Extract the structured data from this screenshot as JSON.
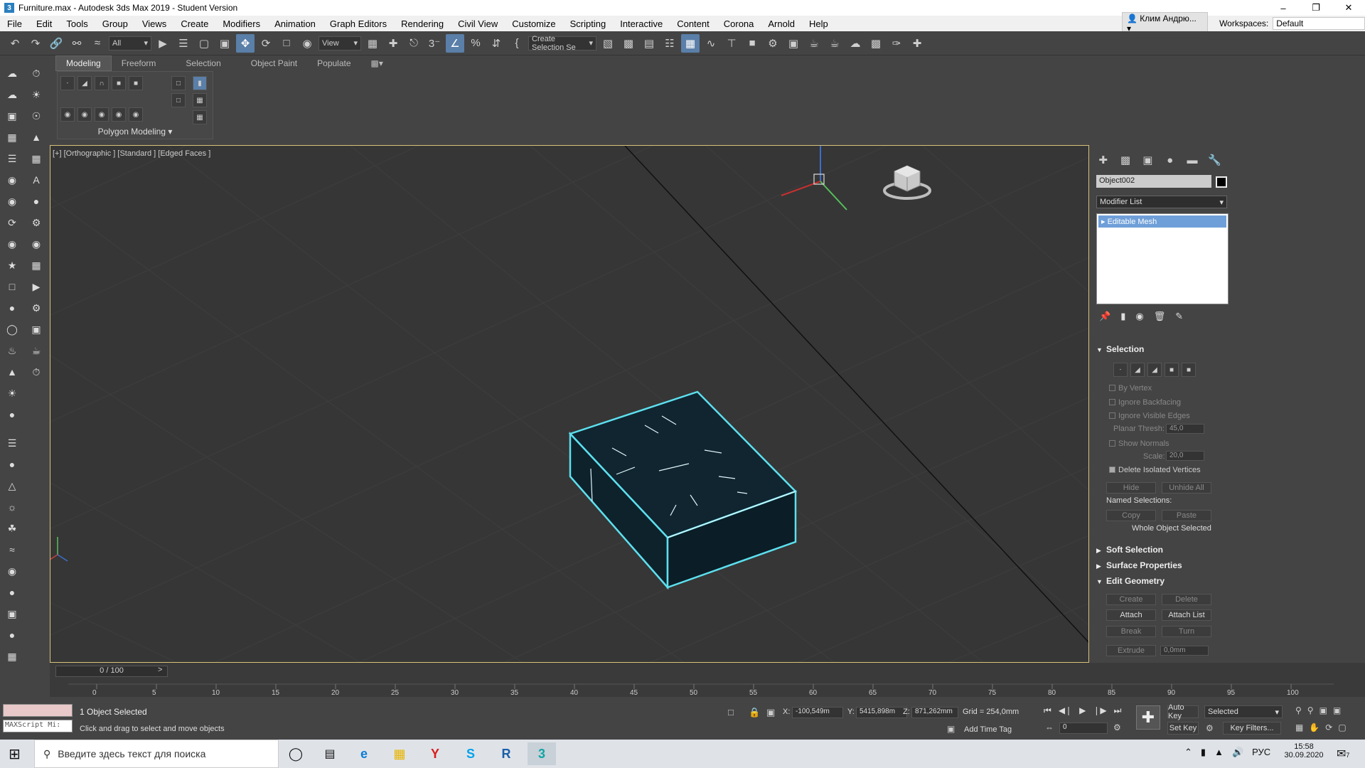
{
  "window": {
    "title": "Furniture.max - Autodesk 3ds Max 2019 - Student Version"
  },
  "menu": {
    "items": [
      "File",
      "Edit",
      "Tools",
      "Group",
      "Views",
      "Create",
      "Modifiers",
      "Animation",
      "Graph Editors",
      "Rendering",
      "Civil View",
      "Customize",
      "Scripting",
      "Interactive",
      "Content",
      "Corona",
      "Arnold",
      "Help"
    ],
    "user": "Клим Андрю...",
    "workspaces_label": "Workspaces:",
    "workspace": "Default"
  },
  "toolbar": {
    "filter": "All",
    "refcoord": "View",
    "selection_set": "Create Selection Se"
  },
  "ribbon": {
    "tabs": [
      "Modeling",
      "Freeform",
      "Selection",
      "Object Paint",
      "Populate"
    ],
    "panel_label": "Polygon Modeling"
  },
  "viewport": {
    "label": "[+] [Orthographic ] [Standard ] [Edged Faces ]"
  },
  "command_panel": {
    "object_name": "Object002",
    "modifier_list": "Modifier List",
    "stack_item": "Editable Mesh",
    "rollouts": {
      "selection": "Selection",
      "by_vertex": "By Vertex",
      "ignore_backfacing": "Ignore Backfacing",
      "ignore_visible_edges": "Ignore Visible Edges",
      "planar_thresh_label": "Planar Thresh:",
      "planar_thresh": "45,0",
      "show_normals": "Show Normals",
      "scale_label": "Scale:",
      "scale": "20,0",
      "delete_isolated": "Delete Isolated Vertices",
      "hide": "Hide",
      "unhide_all": "Unhide All",
      "named_selections": "Named Selections:",
      "copy": "Copy",
      "paste": "Paste",
      "whole_object": "Whole Object Selected",
      "soft_selection": "Soft Selection",
      "surface_properties": "Surface Properties",
      "edit_geometry": "Edit Geometry",
      "create": "Create",
      "delete": "Delete",
      "attach": "Attach",
      "attach_list": "Attach List",
      "break": "Break",
      "turn": "Turn",
      "extrude": "Extrude",
      "extrude_val": "0,0mm"
    }
  },
  "timeline": {
    "slider": "0 / 100",
    "ticks": [
      "0",
      "5",
      "10",
      "15",
      "20",
      "25",
      "30",
      "35",
      "40",
      "45",
      "50",
      "55",
      "60",
      "65",
      "70",
      "75",
      "80",
      "85",
      "90",
      "95",
      "100"
    ]
  },
  "status": {
    "maxscript": "MAXScript Mi:",
    "selected": "1 Object Selected",
    "prompt": "Click and drag to select and move objects",
    "x_label": "X:",
    "x": "-100,549m",
    "y_label": "Y:",
    "y": "5415,898m",
    "z_label": "Z:",
    "z": "871,262mm",
    "grid": "Grid = 254,0mm",
    "add_time_tag": "Add Time Tag",
    "auto_key": "Auto Key",
    "set_key": "Set Key",
    "key_selected": "Selected",
    "key_filters": "Key Filters...",
    "frame": "0"
  },
  "taskbar": {
    "search_placeholder": "Введите здесь текст для поиска",
    "lang": "РУС",
    "time": "15:58",
    "date": "30.09.2020",
    "notif_count": "7"
  }
}
